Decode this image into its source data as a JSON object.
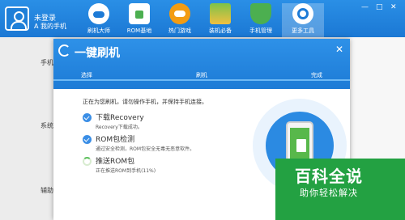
{
  "topbar": {
    "user_name": "未登录",
    "user_sub": "A 我的手机",
    "nav": [
      {
        "label": "刷机大师",
        "icon": "cloud-icon"
      },
      {
        "label": "ROM基地",
        "icon": "android-bag-icon"
      },
      {
        "label": "热门游戏",
        "icon": "gamepad-icon"
      },
      {
        "label": "装机必备",
        "icon": "apps-grid-icon"
      },
      {
        "label": "手机管理",
        "icon": "shield-icon"
      },
      {
        "label": "更多工具",
        "icon": "tools-icon"
      }
    ],
    "window_controls": [
      "—",
      "□",
      "✕"
    ]
  },
  "background": {
    "labels": [
      "手机",
      "系统",
      "辅助"
    ]
  },
  "dialog": {
    "title": "一键刷机",
    "close": "✕",
    "steps": [
      "选择",
      "刷机",
      "完成"
    ],
    "instruction": "正在为您刷机，请勿操作手机，并保持手机连接。",
    "items": [
      {
        "title": "下载Recovery",
        "sub": "Recovery下载成功。",
        "status": "done"
      },
      {
        "title": "ROM包检测",
        "sub": "通过安全检测，ROM包安全无毒无恶意软件。",
        "status": "done"
      },
      {
        "title": "推送ROM包",
        "sub": "正在推送ROM到手机(11%)",
        "status": "in-progress",
        "progress": 0.11
      }
    ]
  },
  "watermark": {
    "title": "百科全说",
    "sub": "助你轻松解决"
  },
  "colors": {
    "brand_blue": "#1d7bd6",
    "check_blue": "#3a8ee6",
    "progress_green": "#5cc05c",
    "watermark_green": "#23a142"
  }
}
